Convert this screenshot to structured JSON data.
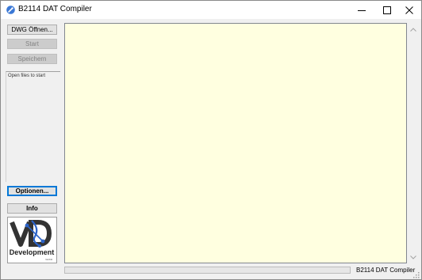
{
  "window": {
    "title": "B2114 DAT Compiler",
    "app_icon": "wrench-icon",
    "controls": [
      "minimize-icon",
      "maximize-icon",
      "close-icon"
    ]
  },
  "sidebar": {
    "buttons": {
      "open": "DWG Öffnen...",
      "start": "Start",
      "save": "Speichern",
      "options": "Optionen...",
      "info": "Info"
    },
    "status_text": "Open files to start",
    "logo": {
      "text_main": "VD",
      "text_sub": "Development",
      "text_small": "GmbH"
    }
  },
  "main": {
    "output_text": "",
    "background_color": "#ffffe0"
  },
  "statusbar": {
    "progress_fraction": 0,
    "label": "B2114 DAT Compiler"
  },
  "colors": {
    "accent": "#0078d7",
    "logo_blue": "#2b63c8",
    "logo_dark": "#333333"
  }
}
